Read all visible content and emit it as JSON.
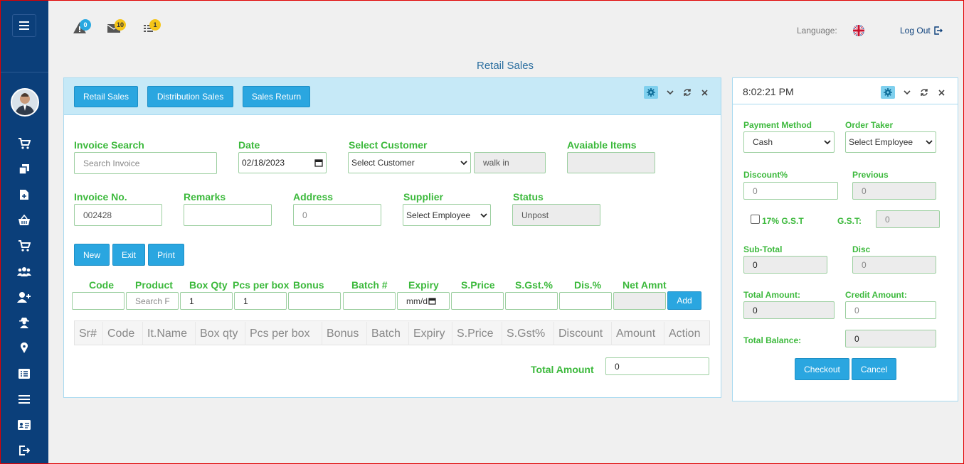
{
  "topbar": {
    "alerts_badge": "0",
    "messages_badge": "10",
    "tasks_badge": "1",
    "language_label": "Language:",
    "logout_label": "Log Out"
  },
  "page_title": "Retail Sales",
  "tabs": {
    "retail": "Retail Sales",
    "distribution": "Distribution Sales",
    "returns": "Sales Return"
  },
  "form": {
    "invoice_search_label": "Invoice Search",
    "invoice_search_placeholder": "Search Invoice",
    "date_label": "Date",
    "date_value": "02/18/2023",
    "customer_label": "Select Customer",
    "customer_value": "Select Customer",
    "customer_name": "walk in",
    "available_label": "Avaiable Items",
    "invoice_no_label": "Invoice No.",
    "invoice_no_value": "002428",
    "remarks_label": "Remarks",
    "address_label": "Address",
    "address_value": "0",
    "supplier_label": "Supplier",
    "supplier_value": "Select Employee",
    "status_label": "Status",
    "status_value": "Unpost"
  },
  "actions": {
    "new": "New",
    "exit": "Exit",
    "print": "Print"
  },
  "entry": {
    "code_label": "Code",
    "product_label": "Product",
    "product_placeholder": "Search F",
    "box_qty_label": "Box Qty",
    "box_qty_value": "1",
    "pcs_label": "Pcs per box",
    "pcs_value": "1",
    "bonus_label": "Bonus",
    "batch_label": "Batch #",
    "expiry_label": "Expiry",
    "expiry_value": "mm/d",
    "sprice_label": "S.Price",
    "sgst_label": "S.Gst.%",
    "dis_label": "Dis.%",
    "net_label": "Net Amnt",
    "add_label": "Add"
  },
  "table": {
    "columns": [
      "Sr#",
      "Code",
      "It.Name",
      "Box qty",
      "Pcs per box",
      "Bonus",
      "Batch",
      "Expiry",
      "S.Price",
      "S.Gst%",
      "Discount",
      "Amount",
      "Action"
    ]
  },
  "total_amount_label": "Total Amount",
  "total_amount_value": "0",
  "checkout": {
    "time": "8:02:21 PM",
    "payment_method_label": "Payment Method",
    "payment_method_value": "Cash",
    "order_taker_label": "Order Taker",
    "order_taker_value": "Select Employee",
    "discount_label": "Discount%",
    "discount_value": "0",
    "previous_label": "Previous",
    "previous_value": "0",
    "gst_check_label": "17% G.S.T",
    "gst_label": "G.S.T:",
    "gst_value": "0",
    "subtotal_label": "Sub-Total",
    "subtotal_value": "0",
    "disc_label": "Disc",
    "disc_value": "0",
    "total_amount_label": "Total Amount:",
    "total_amount_value": "0",
    "credit_label": "Credit Amount:",
    "credit_value": "0",
    "balance_label": "Total Balance:",
    "balance_value": "0",
    "checkout_btn": "Checkout",
    "cancel_btn": "Cancel"
  }
}
